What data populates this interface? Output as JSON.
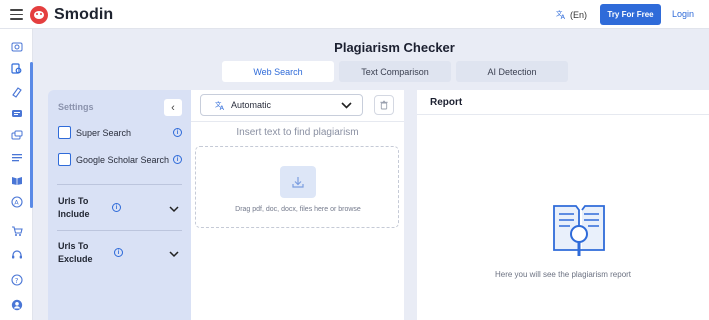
{
  "header": {
    "brand": "Smodin",
    "language": "(En)",
    "try_button": "Try For Free",
    "login": "Login",
    "accent_color": "#2f6bd9",
    "logo_color": "#e43f3f"
  },
  "rail": {
    "icons": [
      "summarize-icon",
      "plagiarism-icon",
      "eraser-icon",
      "chat-icon",
      "translate-icon",
      "list-icon",
      "book-icon",
      "author-icon",
      "cart-icon",
      "headset-icon",
      "help-icon",
      "account-icon"
    ]
  },
  "main": {
    "title": "Plagiarism Checker",
    "tabs": [
      {
        "label": "Web Search",
        "active": true
      },
      {
        "label": "Text Comparison",
        "active": false
      },
      {
        "label": "AI Detection",
        "active": false
      }
    ]
  },
  "settings": {
    "title": "Settings",
    "options": [
      {
        "label": "Super Search",
        "checked": false
      },
      {
        "label": "Google Scholar Search",
        "checked": false
      }
    ],
    "urls_include": [
      "Urls To",
      "Include"
    ],
    "urls_exclude": [
      "Urls To",
      "Exclude"
    ]
  },
  "input": {
    "language_select": "Automatic",
    "placeholder": "Insert text to find plagiarism",
    "drop_text": "Drag pdf, doc, docx, files here or browse"
  },
  "report": {
    "title": "Report",
    "empty_message": "Here you will see the plagiarism report"
  }
}
